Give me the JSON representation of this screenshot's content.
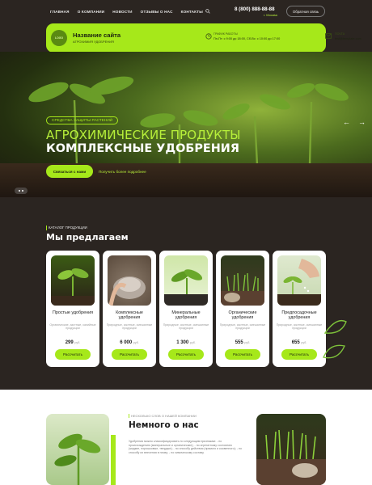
{
  "nav": {
    "items": [
      "ГЛАВНАЯ",
      "О КОМПАНИИ",
      "НОВОСТИ",
      "ОТЗЫВЫ О НАС",
      "КОНТАКТЫ"
    ],
    "phone": "8 (800) 888-88-88",
    "city": "г. Москва",
    "callback_label": "Обратная связь"
  },
  "infobar": {
    "logo_text": "LOGO",
    "site_name": "Название сайта",
    "site_sub": "АГРОХИМИЯ УДОБРЕНИЯ",
    "schedule_label": "График работы",
    "schedule_text": "Пн-Пт: с 9:00 до 18:00, Сб-Вс: с 10:00 до 17:00",
    "mail_label": "Почта",
    "mail_text": "test@template.com"
  },
  "hero": {
    "badge": "СРЕДСТВА ЗАЩИТЫ РАСТЕНИЙ",
    "line1": "АГРОХИМИЧЕСКИЕ ПРОДУКТЫ",
    "line2": "КОМПЛЕКСНЫЕ УДОБРЕНИЯ",
    "cta_label": "Связаться с нами",
    "link_label": "Получить более подробнее",
    "prev_arrow": "←",
    "next_arrow": "→"
  },
  "catalog": {
    "label": "КАТАЛОГ ПРОДУКЦИИ",
    "title": "Мы предлагаем",
    "currency": "руб.",
    "cards": [
      {
        "name": "Простые удобрения",
        "desc": "Органические, азотные, калийные продукции",
        "price": "299",
        "button": "Рассчитать"
      },
      {
        "name": "Комплексные удобрения",
        "desc": "Природные, азотные, смешанные продукции",
        "price": "6 000",
        "button": "Рассчитать"
      },
      {
        "name": "Минеральные удобрения",
        "desc": "Природные, азотные, смешанные продукции",
        "price": "1 300",
        "button": "Рассчитать"
      },
      {
        "name": "Органические удобрения",
        "desc": "Природные, азотные, смешанные продукции",
        "price": "555",
        "button": "Рассчитать"
      },
      {
        "name": "Предпосадочные удобрения",
        "desc": "Природные, азотные, смешанные продукции",
        "price": "655",
        "button": "Рассчитать"
      }
    ]
  },
  "about": {
    "label": "НЕСКОЛЬКО СЛОВ О НАШЕЙ КОМПАНИИ",
    "title": "Немного о нас",
    "text": "Удобрения можно классифицировать по следующим признакам: - по происхождению (минеральные и органические); - по агрегатному состоянию (жидкие, порошковые, твердые); - по способу действия (прямого и косвенного); - по способу их внесения в почву; - по химическому составу."
  },
  "colors": {
    "accent": "#a6e81a",
    "background": "#2b2521",
    "card": "#ffffff"
  }
}
